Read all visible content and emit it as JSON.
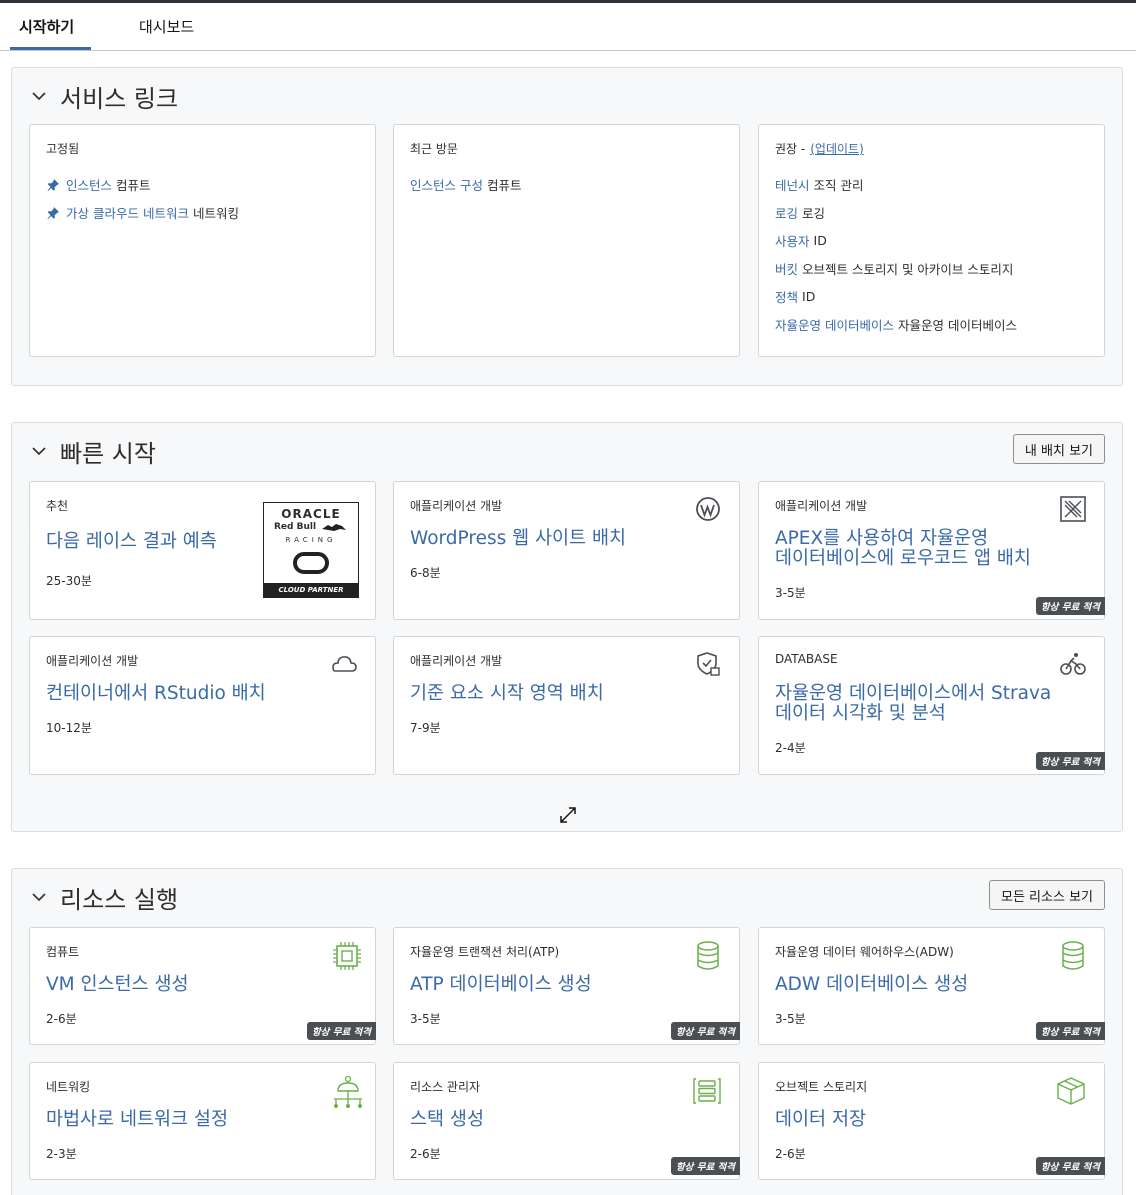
{
  "tabs": [
    {
      "label": "시작하기"
    },
    {
      "label": "대시보드"
    }
  ],
  "service_links": {
    "title": "서비스 링크",
    "pinned": {
      "label": "고정됨",
      "items": [
        {
          "link": "인스턴스",
          "category": "컴퓨트"
        },
        {
          "link": "가상 클라우드 네트워크",
          "category": "네트워킹"
        }
      ]
    },
    "recent": {
      "label": "최근 방문",
      "items": [
        {
          "link": "인스턴스 구성",
          "category": "컴퓨트"
        }
      ]
    },
    "recommended": {
      "label": "권장 -",
      "update": "(업데이트)",
      "items": [
        {
          "link": "테넌시",
          "category": "조직 관리"
        },
        {
          "link": "로깅",
          "category": "로깅"
        },
        {
          "link": "사용자",
          "category": "ID"
        },
        {
          "link": "버킷",
          "category": "오브젝트 스토리지 및 아카이브 스토리지"
        },
        {
          "link": "정책",
          "category": "ID"
        },
        {
          "link": "자율운영 데이터베이스",
          "category": "자율운영 데이터베이스"
        }
      ]
    }
  },
  "quick_start": {
    "title": "빠른 시작",
    "button": "내 배치 보기",
    "cards": [
      {
        "category": "추천",
        "title": "다음 레이스 결과 예측",
        "time": "25-30분",
        "logo": {
          "line1": "ORACLE",
          "line2": "Red Bull",
          "line3": "RACING",
          "line4": "CLOUD PARTNER"
        }
      },
      {
        "category": "애플리케이션 개발",
        "title": "WordPress 웹 사이트 배치",
        "time": "6-8분",
        "icon": "wordpress-icon"
      },
      {
        "category": "애플리케이션 개발",
        "title_line1": "APEX를 사용하여 자율운영",
        "title_line2": "데이터베이스에 로우코드 앱 배치",
        "time": "3-5분",
        "badge": "항상 무료 적격",
        "icon": "apex-icon"
      },
      {
        "category": "애플리케이션 개발",
        "title": "컨테이너에서 RStudio 배치",
        "time": "10-12분",
        "icon": "cloud-icon"
      },
      {
        "category": "애플리케이션 개발",
        "title": "기준 요소 시작 영역 배치",
        "time": "7-9분",
        "icon": "shield-icon"
      },
      {
        "category": "DATABASE",
        "title_line1": "자율운영 데이터베이스에서 Strava",
        "title_line2": "데이터 시각화 및 분석",
        "time": "2-4분",
        "badge": "항상 무료 적격",
        "icon": "cyclist-icon"
      }
    ]
  },
  "resources": {
    "title": "리소스 실행",
    "button": "모든 리소스 보기",
    "cards": [
      {
        "category": "컴퓨트",
        "title": "VM 인스턴스 생성",
        "time": "2-6분",
        "badge": "항상 무료 적격",
        "icon": "chip-icon"
      },
      {
        "category": "자율운영 트랜잭션 처리(ATP)",
        "title": "ATP 데이터베이스 생성",
        "time": "3-5분",
        "badge": "항상 무료 적격",
        "icon": "database-icon"
      },
      {
        "category": "자율운영 데이터 웨어하우스(ADW)",
        "title": "ADW 데이터베이스 생성",
        "time": "3-5분",
        "badge": "항상 무료 적격",
        "icon": "database-icon"
      },
      {
        "category": "네트워킹",
        "title": "마법사로 네트워크 설정",
        "time": "2-3분",
        "icon": "network-icon"
      },
      {
        "category": "리소스 관리자",
        "title": "스택 생성",
        "time": "2-6분",
        "badge": "항상 무료 적격",
        "icon": "stack-icon"
      },
      {
        "category": "오브젝트 스토리지",
        "title": "데이터 저장",
        "time": "2-6분",
        "badge": "항상 무료 적격",
        "icon": "box-icon"
      }
    ]
  },
  "colors": {
    "link": "#3a6aa8",
    "icon_green": "#6ab04c",
    "badge_bg": "#4a4f54"
  }
}
